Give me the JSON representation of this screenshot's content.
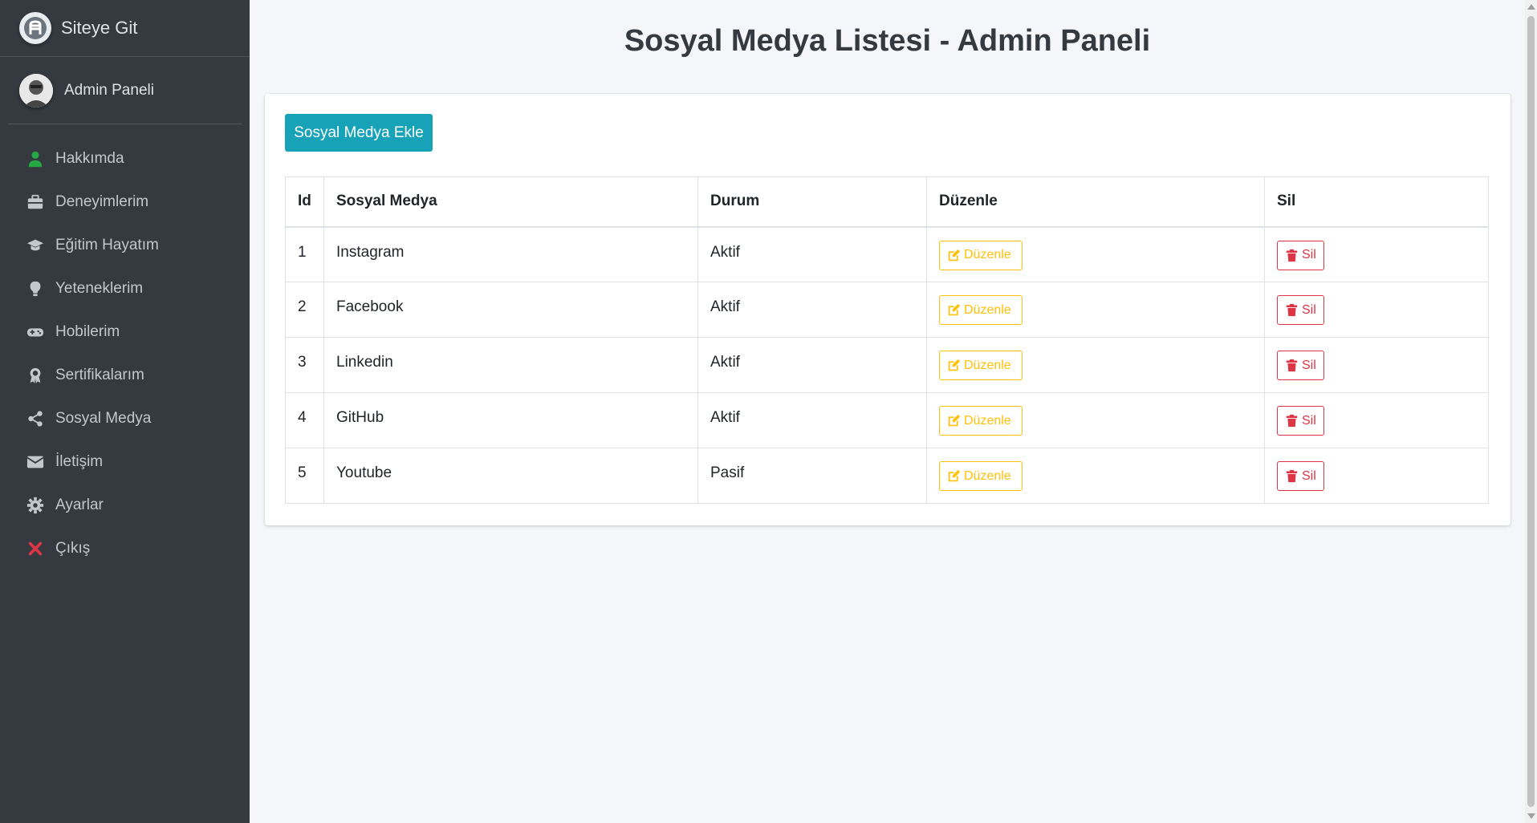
{
  "sidebar": {
    "brand": "Siteye Git",
    "user": "Admin Paneli",
    "items": [
      {
        "label": "Hakkımda",
        "icon": "user-icon",
        "color": "#28a745"
      },
      {
        "label": "Deneyimlerim",
        "icon": "briefcase-icon",
        "color": "#c2c7d0"
      },
      {
        "label": "Eğitim Hayatım",
        "icon": "graduation-cap-icon",
        "color": "#c2c7d0"
      },
      {
        "label": "Yeteneklerim",
        "icon": "lightbulb-icon",
        "color": "#c2c7d0"
      },
      {
        "label": "Hobilerim",
        "icon": "gamepad-icon",
        "color": "#c2c7d0"
      },
      {
        "label": "Sertifikalarım",
        "icon": "award-icon",
        "color": "#c2c7d0"
      },
      {
        "label": "Sosyal Medya",
        "icon": "share-icon",
        "color": "#c2c7d0"
      },
      {
        "label": "İletişim",
        "icon": "envelope-icon",
        "color": "#c2c7d0"
      },
      {
        "label": "Ayarlar",
        "icon": "gear-icon",
        "color": "#c2c7d0"
      },
      {
        "label": "Çıkış",
        "icon": "close-icon",
        "color": "#dc3545"
      }
    ]
  },
  "main": {
    "title": "Sosyal Medya Listesi - Admin Paneli",
    "add_button": "Sosyal Medya Ekle",
    "table": {
      "headers": [
        "Id",
        "Sosyal Medya",
        "Durum",
        "Düzenle",
        "Sil"
      ],
      "rows": [
        {
          "id": "1",
          "name": "Instagram",
          "status": "Aktif"
        },
        {
          "id": "2",
          "name": "Facebook",
          "status": "Aktif"
        },
        {
          "id": "3",
          "name": "Linkedin",
          "status": "Aktif"
        },
        {
          "id": "4",
          "name": "GitHub",
          "status": "Aktif"
        },
        {
          "id": "5",
          "name": "Youtube",
          "status": "Pasif"
        }
      ],
      "edit_label": "Düzenle",
      "delete_label": "Sil"
    }
  },
  "colors": {
    "sidebar_bg": "#343a40",
    "accent": "#17a2b8",
    "warning": "#ffc107",
    "danger": "#dc3545"
  }
}
